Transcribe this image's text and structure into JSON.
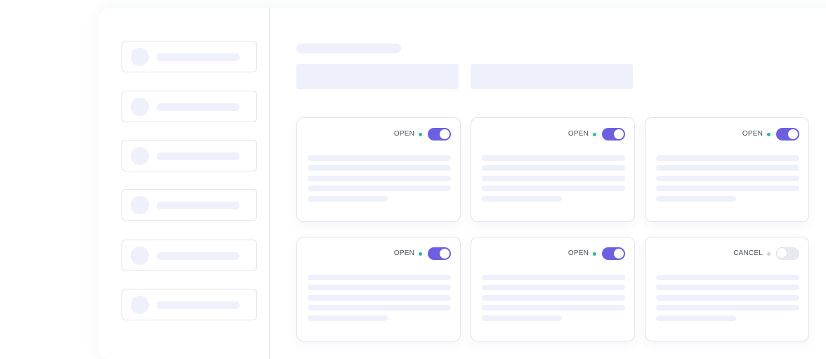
{
  "colors": {
    "accent": "#6c5fe0",
    "open_dot": "#2dbd8c",
    "cancel_dot": "#cfd2da",
    "toggle_off_bg": "#e8e9ee",
    "skeleton": "#eef0fb"
  },
  "sidebar": {
    "items": [
      {
        "id": "item-1"
      },
      {
        "id": "item-2"
      },
      {
        "id": "item-3"
      },
      {
        "id": "item-4"
      },
      {
        "id": "item-5"
      },
      {
        "id": "item-6"
      }
    ]
  },
  "cards": [
    {
      "status": "OPEN",
      "toggle_on": true
    },
    {
      "status": "OPEN",
      "toggle_on": true
    },
    {
      "status": "OPEN",
      "toggle_on": true
    },
    {
      "status": "OPEN",
      "toggle_on": true
    },
    {
      "status": "OPEN",
      "toggle_on": true
    },
    {
      "status": "CANCEL",
      "toggle_on": false
    }
  ]
}
